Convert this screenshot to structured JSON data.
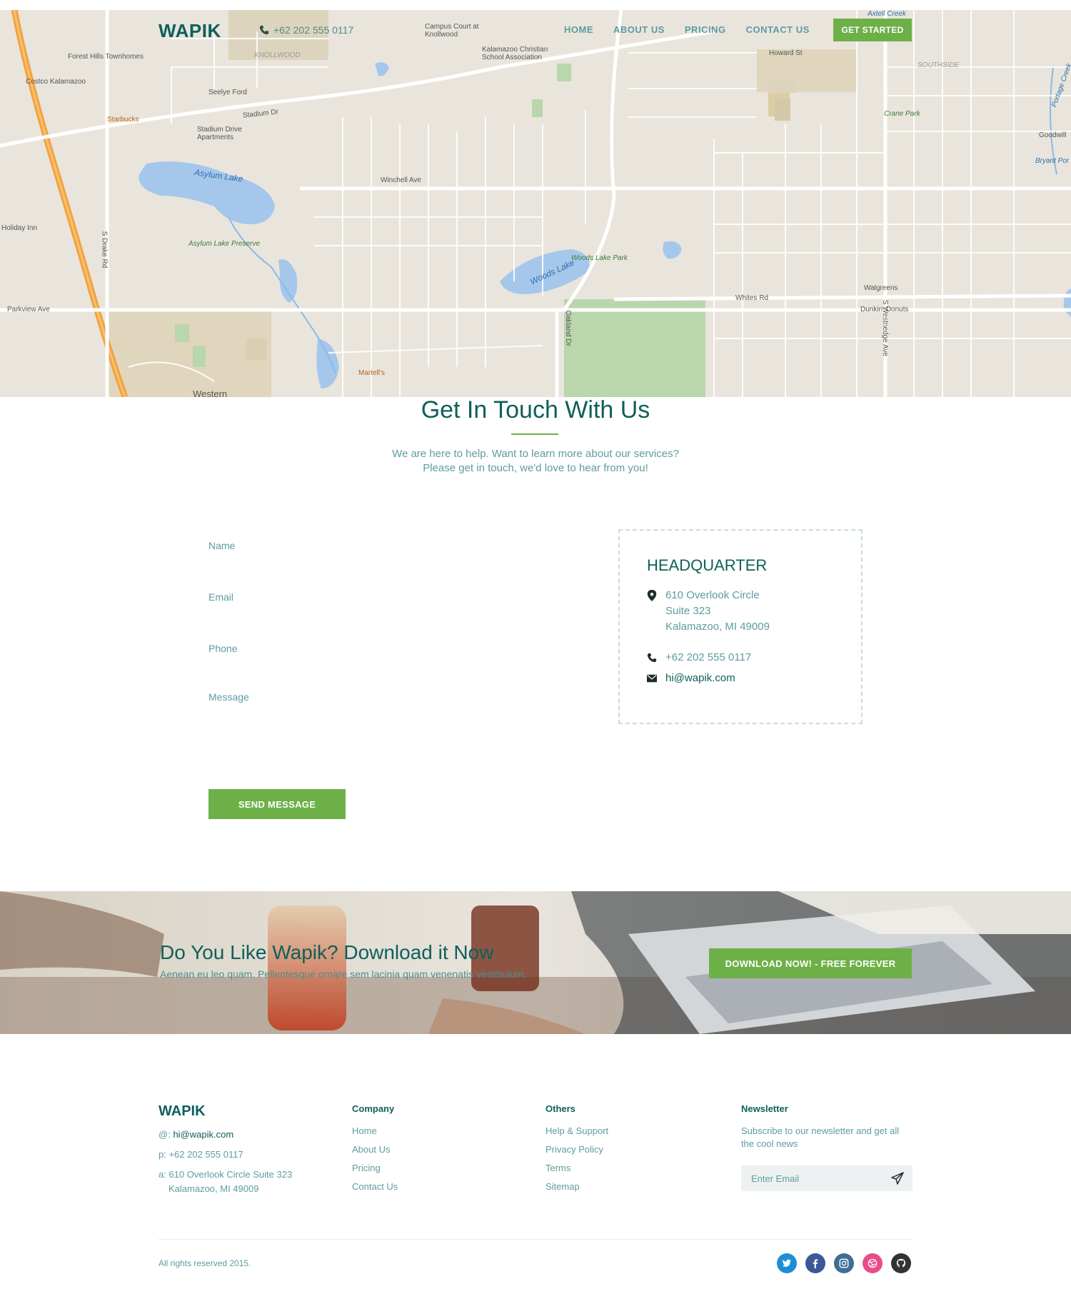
{
  "header": {
    "logo": "WAPIK",
    "phone": "+62 202 555 0117",
    "nav": [
      "HOME",
      "ABOUT US",
      "PRICING",
      "CONTACT US"
    ],
    "cta": "GET STARTED"
  },
  "map": {
    "labels": {
      "asylum_lake": "Asylum Lake",
      "asylum_lake_preserve": "Asylum Lake Preserve",
      "woods_lake": "Woods Lake",
      "woods_lake_park": "Woods Lake Park",
      "crane_park": "Crane Park",
      "knollwood": "KNOLLWOOD",
      "southside": "SOUTHSIDE",
      "stadium_dr": "Stadium Dr",
      "parkview_ave": "Parkview Ave",
      "whites_rd": "Whites Rd",
      "winchell_ave": "Winchell Ave",
      "howard_st": "Howard St",
      "oakland_dr": "Oakland Dr",
      "drake_rd": "S Drake Rd",
      "westnedge_ave": "S Westnedge Ave",
      "western": "Western",
      "forest_hills": "Forest Hills Townhomes",
      "costco": "Costco Kalamazoo",
      "starbucks": "Starbucks",
      "dunkin": "Dunkin' Donuts",
      "walgreens": "Walgreens",
      "campus_court": "Campus Court at Knollwood",
      "kalamazoo_christian": "Kalamazoo Christian School Association",
      "stadium_drive_apts": "Stadium Drive Apartments",
      "holiday_inn": "Holiday Inn",
      "seelye_ford": "Seelye Ford",
      "martells": "Martell's",
      "axtell_creek": "Axtell Creek",
      "portage_creek": "Portage Creek",
      "bryant": "Bryant Por",
      "goodwill": "Goodwill"
    }
  },
  "contact": {
    "title": "Get In Touch With Us",
    "subtitle_line1": "We are here to help. Want to learn more about our services?",
    "subtitle_line2": "Please get in touch, we'd love to hear from you!",
    "form": {
      "name_placeholder": "Name",
      "email_placeholder": "Email",
      "phone_placeholder": "Phone",
      "message_placeholder": "Message",
      "submit": "SEND MESSAGE"
    },
    "hq": {
      "title": "HEADQUARTER",
      "address_line1": "610 Overlook Circle",
      "address_line2": "Suite 323",
      "address_line3": "Kalamazoo, MI 49009",
      "phone": "+62 202 555 0117",
      "email": "hi@wapik.com"
    }
  },
  "banner": {
    "title": "Do You Like Wapik? Download it Now",
    "subtitle": "Aenean eu leo quam. Pellentesque ornare sem lacinia quam venenatis vestibulum.",
    "cta": "DOWNLOAD NOW! - FREE FOREVER"
  },
  "footer": {
    "logo": "WAPIK",
    "email_prefix": "@:",
    "email": "hi@wapik.com",
    "phone_prefix": "p:",
    "phone": "+62 202 555 0117",
    "address_prefix": "a:",
    "address_line1": "610 Overlook Circle Suite 323",
    "address_line2": "Kalamazoo, MI 49009",
    "company": {
      "heading": "Company",
      "links": [
        "Home",
        "About Us",
        "Pricing",
        "Contact Us"
      ]
    },
    "others": {
      "heading": "Others",
      "links": [
        "Help & Support",
        "Privacy Policy",
        "Terms",
        "Sitemap"
      ]
    },
    "newsletter": {
      "heading": "Newsletter",
      "text": "Subscribe to our newsletter and get all the cool news",
      "placeholder": "Enter Email"
    },
    "copyright": "All rights reserved 2015.",
    "social": [
      "twitter-icon",
      "facebook-icon",
      "instagram-icon",
      "dribbble-icon",
      "github-icon"
    ]
  },
  "colors": {
    "brand_green": "#6db048",
    "brand_teal": "#0f5f5b",
    "text_teal": "#5d9ca0"
  }
}
